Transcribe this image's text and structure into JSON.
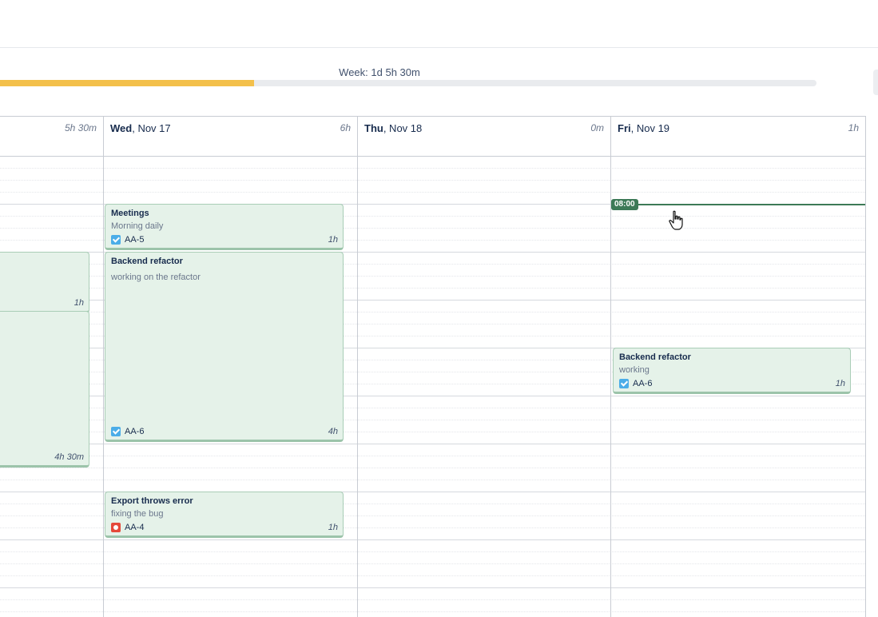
{
  "week": {
    "label": "Week: 1d 5h 30m",
    "progress_fraction": 0.311
  },
  "columns": [
    {
      "day_bold": "",
      "day_rest": "",
      "total": "5h 30m"
    },
    {
      "day_bold": "Wed",
      "day_rest": ", Nov 17",
      "total": "6h"
    },
    {
      "day_bold": "Thu",
      "day_rest": ", Nov 18",
      "total": "0m"
    },
    {
      "day_bold": "Fri",
      "day_rest": ", Nov 19",
      "total": "1h"
    }
  ],
  "entries": {
    "tue_a": {
      "duration": "1h"
    },
    "tue_b": {
      "duration": "4h 30m"
    },
    "wed_meetings": {
      "title": "Meetings",
      "description": "Morning daily",
      "issue_key": "AA-5",
      "duration": "1h"
    },
    "wed_backend": {
      "title": "Backend refactor",
      "description": "working on the refactor",
      "issue_key": "AA-6",
      "duration": "4h"
    },
    "wed_export": {
      "title": "Export throws error",
      "description": "fixing the bug",
      "issue_key": "AA-4",
      "duration": "1h"
    },
    "fri_backend": {
      "title": "Backend refactor",
      "description": "working",
      "issue_key": "AA-6",
      "duration": "1h"
    }
  },
  "now_indicator": {
    "time": "08:00"
  },
  "colors": {
    "progress": "#f3c04b",
    "entry_bg": "#e5f2e9",
    "now": "#3d7a57",
    "task_icon": "#4bade8",
    "bug_icon": "#e5493a"
  },
  "icons": {
    "task": "checkbox-task-icon",
    "bug": "bug-icon",
    "cursor": "hand-pointer-icon"
  }
}
